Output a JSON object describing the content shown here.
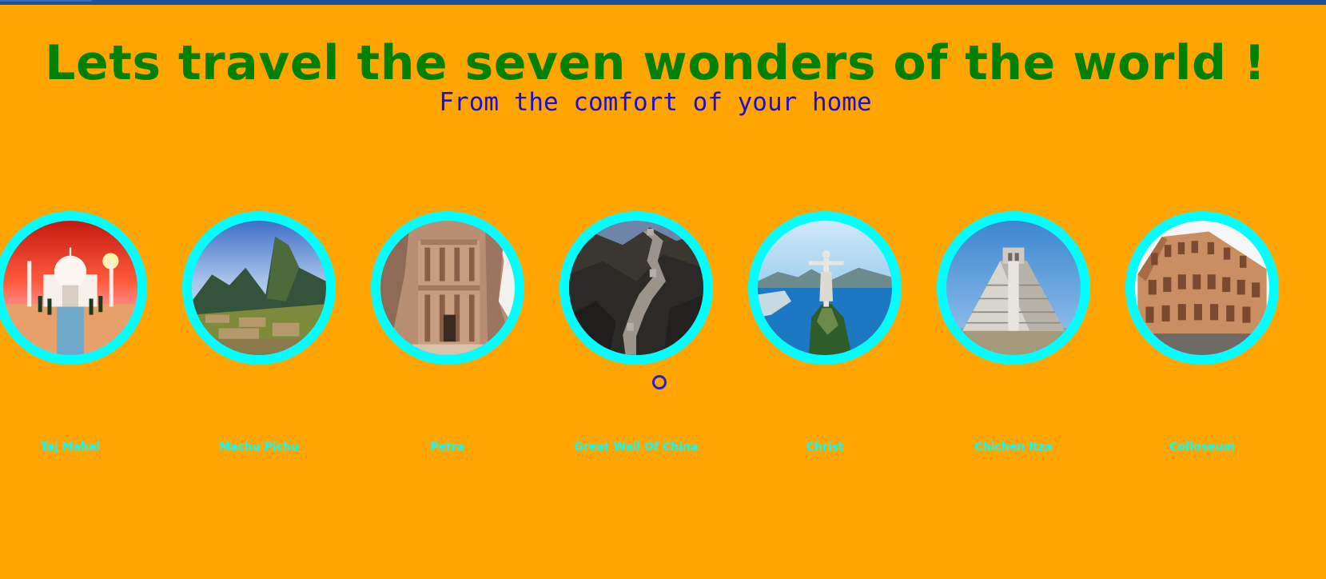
{
  "header": {
    "title": "Lets travel the seven wonders of the world !",
    "subtitle": "From the comfort of your home"
  },
  "colors": {
    "background": "#ffa500",
    "title": "#008000",
    "subtitle": "#1a0dd8",
    "ring": "#00ffff",
    "label": "#00ffff",
    "topbar": "#1f4f9a"
  },
  "wonders": [
    {
      "label": "Taj Mahal",
      "icon": "taj-mahal-photo"
    },
    {
      "label": "Machu Pichu",
      "icon": "machu-pichu-photo"
    },
    {
      "label": "Petra",
      "icon": "petra-photo"
    },
    {
      "label": "Great Wall Of China",
      "icon": "great-wall-photo"
    },
    {
      "label": "Christ",
      "icon": "christ-redeemer-photo"
    },
    {
      "label": "Chichen Itza",
      "icon": "chichen-itza-photo"
    },
    {
      "label": "Colloseum",
      "icon": "colosseum-photo"
    }
  ]
}
